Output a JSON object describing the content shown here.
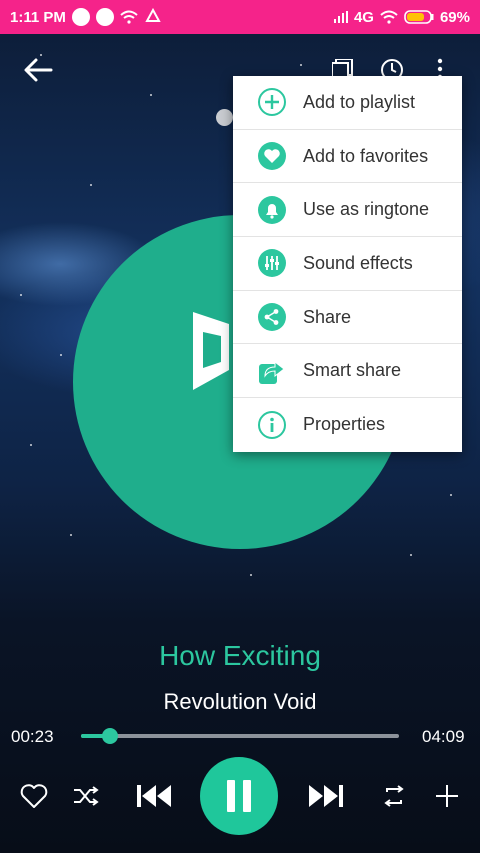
{
  "status_bar": {
    "time": "1:11 PM",
    "network": "4G",
    "battery": "69%",
    "color": "#f5238a"
  },
  "menu": {
    "items": [
      {
        "label": "Add to playlist",
        "icon": "plus-circle-icon"
      },
      {
        "label": "Add to favorites",
        "icon": "heart-icon"
      },
      {
        "label": "Use as ringtone",
        "icon": "bell-icon"
      },
      {
        "label": "Sound effects",
        "icon": "equalizer-icon"
      },
      {
        "label": "Share",
        "icon": "share-icon"
      },
      {
        "label": "Smart share",
        "icon": "smart-share-icon"
      },
      {
        "label": "Properties",
        "icon": "info-icon"
      }
    ],
    "accent": "#2cc79f"
  },
  "song": {
    "title": "How Exciting",
    "artist": "Revolution Void"
  },
  "progress": {
    "elapsed": "00:23",
    "total": "04:09",
    "fraction": 0.09
  },
  "colors": {
    "accent": "#2cc79f",
    "disc": "#1fae8c",
    "play_button": "#1fc79b"
  }
}
